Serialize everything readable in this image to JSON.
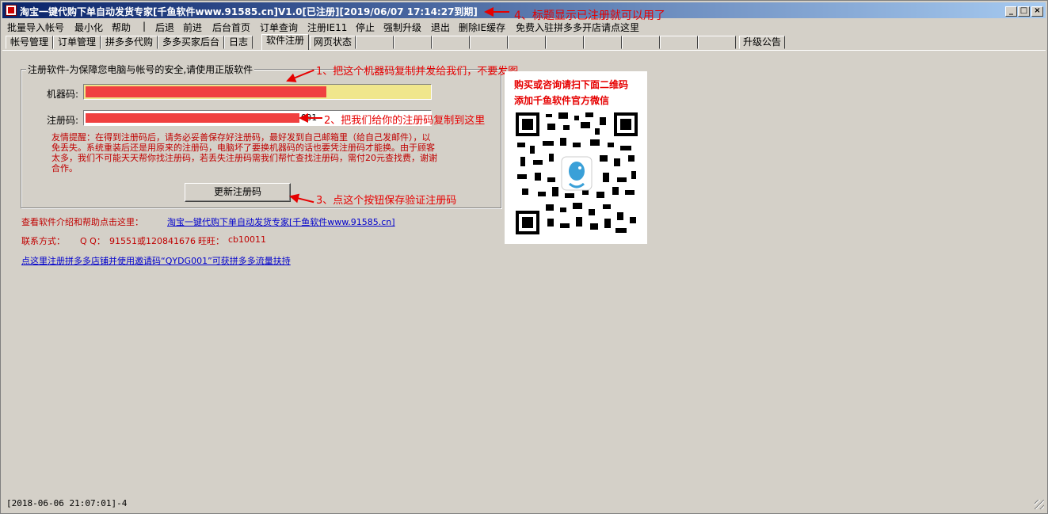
{
  "window": {
    "title": "淘宝一键代购下单自动发货专家[千鱼软件www.91585.cn]V1.0[已注册][2019/06/07 17:14:27到期]",
    "controls": [
      "_",
      "□",
      "×"
    ]
  },
  "annotations": {
    "a4": "4、标题显示已注册就可以用了",
    "a1": "1、把这个机器码复制并发给我们，不要发图",
    "a2": "2、把我们给你的注册码复制到这里",
    "a3": "3、点这个按钮保存验证注册码"
  },
  "menu": {
    "items": [
      "批量导入帐号",
      "最小化",
      "帮助",
      "|",
      "后退",
      "前进",
      "后台首页",
      "订单查询",
      "注册IE11",
      "停止",
      "强制升级",
      "退出",
      "删除IE缓存",
      "免费入驻拼多多开店请点这里"
    ]
  },
  "tabs": {
    "items": [
      "帐号管理",
      "订单管理",
      "拼多多代购",
      "多多买家后台",
      "日志",
      "软件注册",
      "网页状态",
      "",
      "",
      "",
      "",
      "",
      "",
      "",
      "",
      "",
      "升级公告"
    ],
    "active": "软件注册"
  },
  "register": {
    "group_title": "注册软件-为保障您电脑与帐号的安全,请使用正版软件",
    "machine_code_label": "机器码:",
    "register_code_label": "注册码:",
    "register_code_suffix": "001",
    "tip": "友情提醒：在得到注册码后，请务必妥善保存好注册码，最好发到自己邮箱里（给自己发邮件），以免丢失。系统重装后还是用原来的注册码，电脑坏了要换机器码的话也要凭注册码才能换。由于顾客太多，我们不可能天天帮你找注册码，若丢失注册码需我们帮忙查找注册码，需付20元查找费，谢谢合作。",
    "update_button": "更新注册码"
  },
  "info": {
    "help_label": "查看软件介绍和帮助点击这里：",
    "help_link": "淘宝一键代购下单自动发货专家[千鱼软件www.91585.cn]",
    "contact_label": "联系方式：",
    "qq_label": "Q Q：",
    "qq_value": "91551或120841676",
    "wangwang_label": "旺旺：",
    "wangwang_value": "cb10011",
    "pdd_link": "点这里注册拼多多店铺并使用邀请码“QYDG001”可获拼多多流量扶持"
  },
  "qr": {
    "line1": "购买或咨询请扫下面二维码",
    "line2": "添加千鱼软件官方微信"
  },
  "status": {
    "text": "[2018-06-06 21:07:01]-4"
  },
  "colors": {
    "title_start": "#0a246a",
    "title_end": "#a6caf0",
    "annotation_red": "#e60000",
    "machine_code_bg": "#f0e68c"
  }
}
